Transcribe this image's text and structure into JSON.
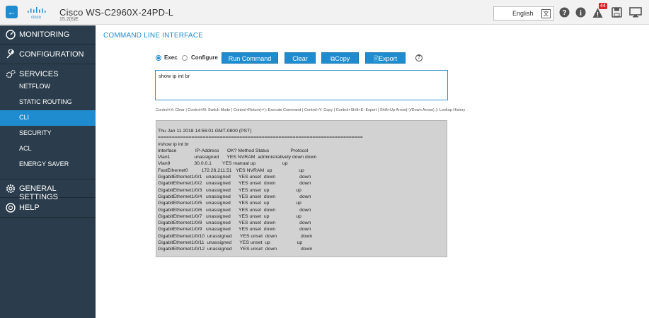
{
  "header": {
    "back_icon": "back-arrow-icon",
    "logo_text": "cisco",
    "device_name": "Cisco WS-C2960X-24PD-L",
    "version": "15.2(6)E",
    "language": "English",
    "alert_count": "44",
    "icons": [
      "help-icon",
      "info-icon",
      "alert-icon",
      "save-icon",
      "monitor-icon"
    ]
  },
  "sidebar": {
    "sections": [
      {
        "label": "MONITORING",
        "icon": "monitoring-icon"
      },
      {
        "label": "CONFIGURATION",
        "icon": "wrench-icon"
      },
      {
        "label": "SERVICES",
        "icon": "gears-icon"
      },
      {
        "label": "GENERAL SETTINGS",
        "icon": "gear-icon"
      },
      {
        "label": "HELP",
        "icon": "help-icon"
      }
    ],
    "services_items": [
      "NETFLOW",
      "STATIC ROUTING",
      "CLI",
      "SECURITY",
      "ACL",
      "ENERGY SAVER"
    ],
    "active_item": "CLI"
  },
  "main": {
    "heading": "COMMAND LINE INTERFACE",
    "mode_exec": "Exec",
    "mode_configure": "Configure",
    "run_label": "Run Command",
    "clear_label": "Clear",
    "copy_label": "Copy",
    "export_label": "Export",
    "help_glyph": "?",
    "command_value": "show ip int br",
    "shortcuts": "Control+X: Clear | Control+M: Switch Mode | Control+Return(↵): Execute Command | Control+Y: Copy | Control+Shift+E: Export | Shift+Up Arrow(↑)/Down Arrow(↓): Lookup History",
    "output_lines": [
      "Thu Jan 11 2018 14:56:01 GMT-0800 (PST)",
      "=========================================================================",
      "#show ip int br",
      "Interface              IP-Address      OK? Method Status                Protocol",
      "Vlan1                  unassigned      YES NVRAM  administratively down down",
      "Vlan9                  30.0.0.1        YES manual up                    up",
      "FastEthernet0          172.26.211.51   YES NVRAM  up                    up",
      "GigabitEthernet1/0/1   unassigned      YES unset  down                  down",
      "GigabitEthernet1/0/2   unassigned      YES unset  down                  down",
      "GigabitEthernet1/0/3   unassigned      YES unset  up                    up",
      "GigabitEthernet1/0/4   unassigned      YES unset  down                  down",
      "GigabitEthernet1/0/5   unassigned      YES unset  up                    up",
      "GigabitEthernet1/0/6   unassigned      YES unset  down                  down",
      "GigabitEthernet1/0/7   unassigned      YES unset  up                    up",
      "GigabitEthernet1/0/8   unassigned      YES unset  down                  down",
      "GigabitEthernet1/0/9   unassigned      YES unset  down                  down",
      "GigabitEthernet1/0/10  unassigned      YES unset  down                  down",
      "GigabitEthernet1/0/11  unassigned      YES unset  up                    up",
      "GigabitEthernet1/0/12  unassigned      YES unset  down                  down"
    ]
  },
  "colors": {
    "accent": "#1f8ccf",
    "sidebar": "#2b3d4c",
    "badge": "#d9252a",
    "output_bg": "#d2d2d2"
  }
}
